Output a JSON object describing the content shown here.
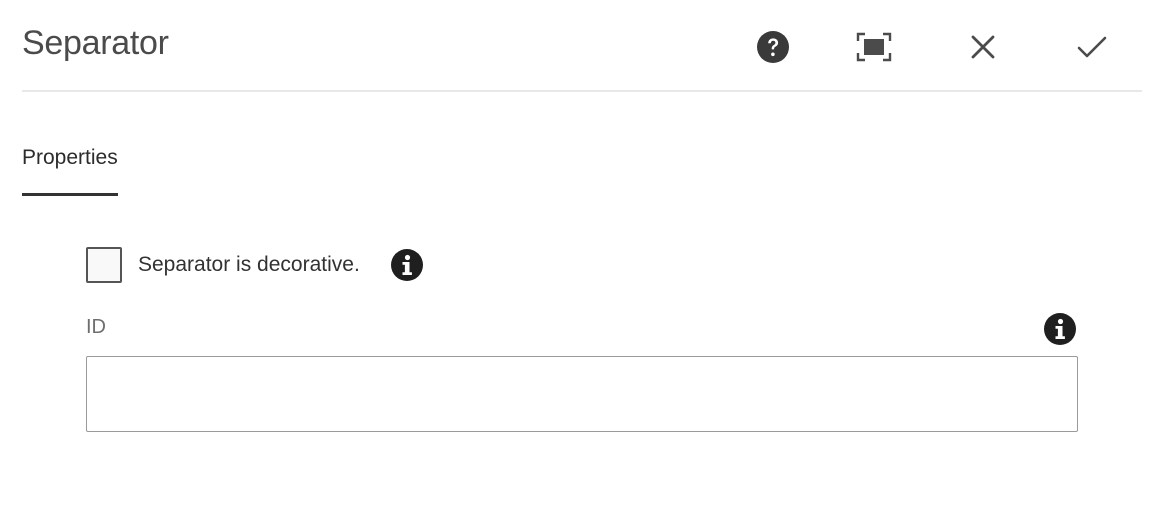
{
  "dialog": {
    "title": "Separator"
  },
  "header_actions": {
    "help_icon": "help-circle-icon",
    "fullscreen_icon": "fullscreen-icon",
    "close_icon": "close-icon",
    "done_icon": "checkmark-icon"
  },
  "tabs": [
    {
      "label": "Properties",
      "active": true
    }
  ],
  "form": {
    "decorative_checkbox": {
      "label": "Separator is decorative.",
      "checked": false,
      "info_icon": "info-icon"
    },
    "id_field": {
      "label": "ID",
      "value": "",
      "placeholder": "",
      "info_icon": "info-icon"
    }
  },
  "colors": {
    "text": "#323232",
    "icon": "#4b4b4b",
    "divider": "#e8e8e8",
    "field_border": "#9a9a9a"
  }
}
